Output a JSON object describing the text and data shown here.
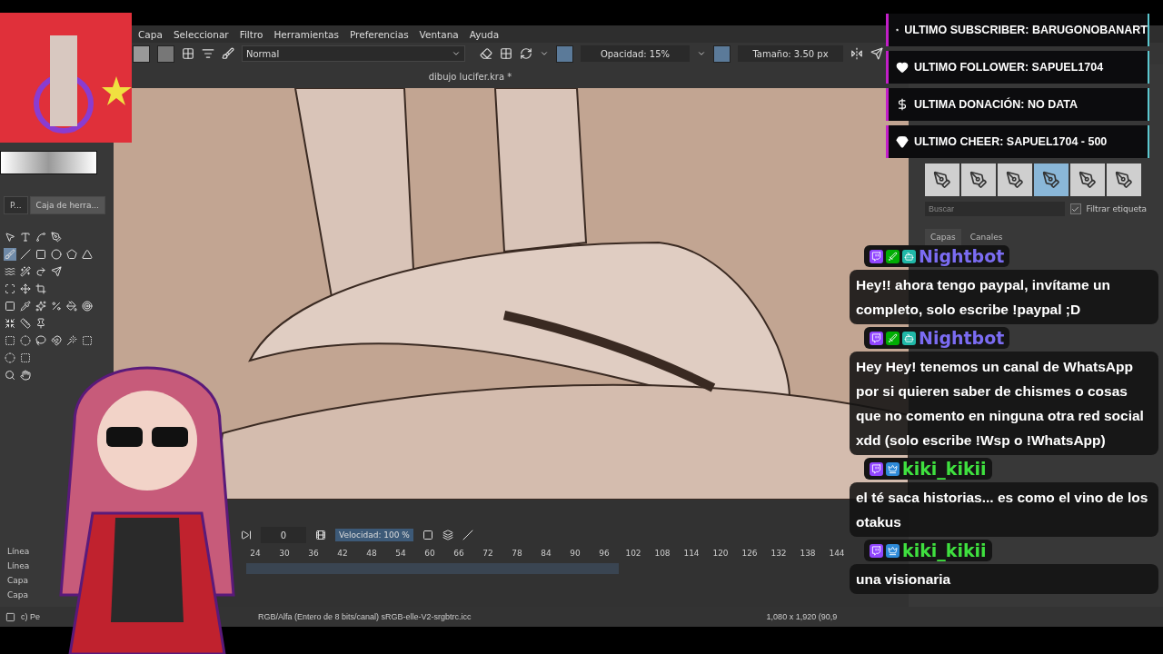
{
  "menu": [
    "Capa",
    "Seleccionar",
    "Filtro",
    "Herramientas",
    "Preferencias",
    "Ventana",
    "Ayuda"
  ],
  "toolbar": {
    "blend_mode": "Normal",
    "opacity": "Opacidad: 15%",
    "size": "Tamaño: 3.50 px"
  },
  "document_title": "dibujo lucifer.kra *",
  "left_panel": {
    "tabs": [
      {
        "label": "P...",
        "selected": false
      },
      {
        "label": "Caja de herra...",
        "selected": true
      }
    ],
    "tool_rows": [
      [
        {
          "selected": false
        },
        {
          "selected": false
        },
        {
          "selected": false
        },
        {
          "selected": false
        }
      ],
      [
        {
          "selected": true
        },
        {
          "selected": false
        },
        {
          "selected": false
        },
        {
          "selected": false
        },
        {
          "selected": false
        },
        {
          "selected": false
        }
      ],
      [
        {
          "selected": false
        },
        {
          "selected": false
        },
        {
          "selected": false
        },
        {
          "selected": false
        }
      ],
      [
        {
          "selected": false
        },
        {
          "selected": false
        },
        {
          "selected": false
        }
      ],
      [
        {
          "selected": false
        },
        {
          "selected": false
        },
        {
          "selected": false
        },
        {
          "selected": false
        },
        {
          "selected": false
        },
        {
          "selected": false
        }
      ],
      [
        {
          "selected": false
        },
        {
          "selected": false
        },
        {
          "selected": false
        }
      ],
      [
        {
          "selected": false
        },
        {
          "selected": false
        },
        {
          "selected": false
        },
        {
          "selected": false
        },
        {
          "selected": false
        },
        {
          "selected": false
        }
      ],
      [
        {
          "selected": false
        },
        {
          "selected": false
        }
      ],
      [
        {
          "selected": false
        },
        {
          "selected": false
        }
      ]
    ],
    "layer_rows": [
      "Línea",
      "Línea",
      "Capa",
      "Capa"
    ]
  },
  "docker": {
    "presets": [
      {
        "selected": false
      },
      {
        "selected": false
      },
      {
        "selected": false
      },
      {
        "selected": true
      },
      {
        "selected": false
      },
      {
        "selected": false
      }
    ],
    "search_placeholder": "Buscar",
    "filter": {
      "label": "Filtrar etiqueta",
      "checked": true
    },
    "tabs": [
      {
        "label": "Capas",
        "selected": true
      },
      {
        "label": "Canales",
        "selected": false
      }
    ]
  },
  "timeline": {
    "frame": "0",
    "speed": "Velocidad: 100 %",
    "ticks": [
      "24",
      "30",
      "36",
      "42",
      "48",
      "54",
      "60",
      "66",
      "72",
      "78",
      "84",
      "90",
      "96",
      "102",
      "108",
      "114",
      "120",
      "126",
      "132",
      "138",
      "144"
    ]
  },
  "status_bar": {
    "left": "c) Pe",
    "color_space": "RGB/Alfa (Entero de 8 bits/canal)  sRGB-elle-V2-srgbtrc.icc",
    "size": "1,080 x 1,920 (90,9"
  },
  "alerts": [
    {
      "kind": "subscriber",
      "text": "ULTIMO SUBSCRIBER: BARUGONOBANART"
    },
    {
      "kind": "follower",
      "text": "ULTIMO FOLLOWER: SAPUEL1704"
    },
    {
      "kind": "donation",
      "text": "ULTIMA DONACIÓN: NO DATA"
    },
    {
      "kind": "cheer",
      "text": "ULTIMO CHEER: SAPUEL1704 - 500"
    }
  ],
  "chat": [
    {
      "kind": "bot",
      "user": "Nightbot",
      "message": "Hey!! ahora tengo paypal, invítame un completo, solo escribe !paypal ;D"
    },
    {
      "kind": "bot",
      "user": "Nightbot",
      "message": "Hey Hey! tenemos un canal de WhatsApp por si quieren saber de chismes o cosas que no comento en ninguna otra red social xdd (solo escribe !Wsp o !WhatsApp)"
    },
    {
      "kind": "subscriber",
      "user": "kiki_kikii",
      "message": "el té saca historias... es como el vino de los otakus"
    },
    {
      "kind": "subscriber",
      "user": "kiki_kikii",
      "message": "una visionaria"
    }
  ]
}
